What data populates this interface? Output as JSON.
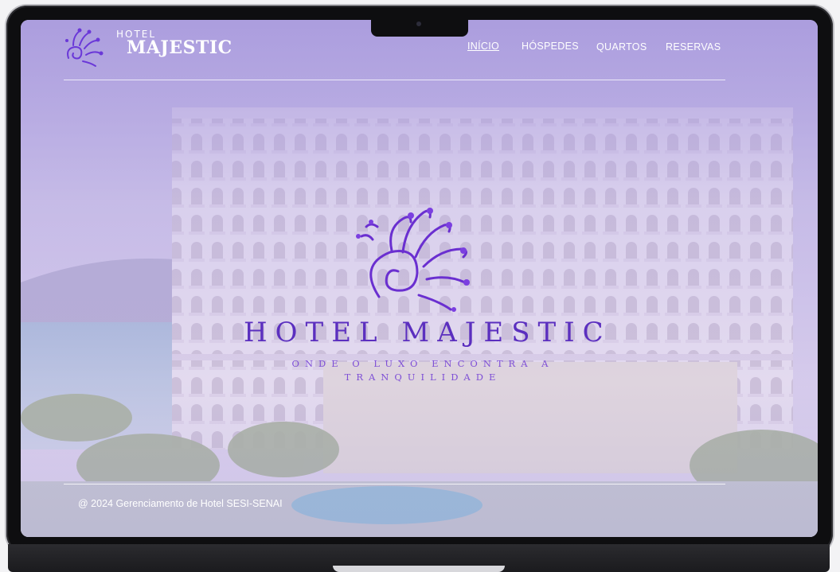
{
  "brand": {
    "small": "HOTEL",
    "big": "MAJESTIC"
  },
  "nav": {
    "items": [
      {
        "label": "INÍCIO",
        "active": true
      },
      {
        "label": "HÓSPEDES",
        "active": false
      },
      {
        "label": "QUARTOS",
        "active": false
      },
      {
        "label": "RESERVAS",
        "active": false
      }
    ]
  },
  "hero": {
    "title": "HOTEL MAJESTIC",
    "tagline": "ONDE O LUXO ENCONTRA A TRANQUILIDADE",
    "icon": "peacock-logo-icon"
  },
  "footer": {
    "text": "@ 2024 Gerenciamento de Hotel SESI-SENAI"
  },
  "colors": {
    "overlay": "#a99bde",
    "brand_purple": "#5b2fbf",
    "nav_text": "#ffffff"
  }
}
